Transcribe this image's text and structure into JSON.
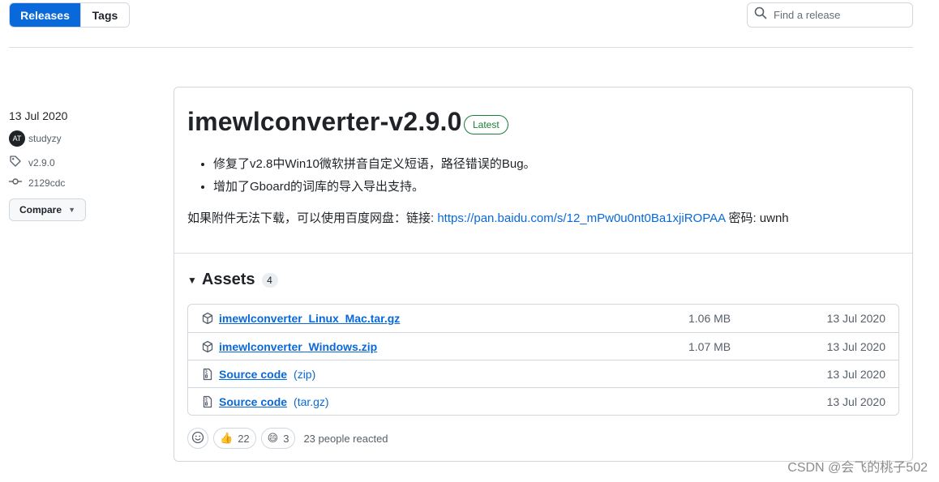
{
  "tabs": [
    {
      "label": "Releases",
      "active": true
    },
    {
      "label": "Tags",
      "active": false
    }
  ],
  "search": {
    "placeholder": "Find a release",
    "value": ""
  },
  "sidebar": {
    "date": "13 Jul 2020",
    "author": "studyzy",
    "avatar_text": "AT",
    "tag": "v2.9.0",
    "commit": "2129cdc",
    "compare_label": "Compare"
  },
  "release": {
    "title": "imewlconverter-v2.9.0",
    "badge": "Latest",
    "notes": [
      "修复了v2.8中Win10微软拼音自定义短语，路径错误的Bug。",
      "增加了Gboard的词库的导入导出支持。"
    ],
    "mirror_prefix": "如果附件无法下载，可以使用百度网盘：链接: ",
    "mirror_link": "https://pan.baidu.com/s/12_mPw0u0nt0Ba1xjiROPAA",
    "mirror_suffix": " 密码: uwnh"
  },
  "assets": {
    "heading": "Assets",
    "count": "4",
    "items": [
      {
        "icon": "package-icon",
        "name": "imewlconverter_Linux_Mac.tar.gz",
        "format": "",
        "size": "1.06 MB",
        "date": "13 Jul 2020"
      },
      {
        "icon": "package-icon",
        "name": "imewlconverter_Windows.zip",
        "format": "",
        "size": "1.07 MB",
        "date": "13 Jul 2020"
      },
      {
        "icon": "file-zip-icon",
        "name": "Source code",
        "format": "(zip)",
        "size": "",
        "date": "13 Jul 2020"
      },
      {
        "icon": "file-zip-icon",
        "name": "Source code",
        "format": "(tar.gz)",
        "size": "",
        "date": "13 Jul 2020"
      }
    ]
  },
  "reactions": {
    "thumbs_up": "22",
    "laugh": "3",
    "summary": "23 people reacted"
  },
  "watermark": "CSDN @会飞的桃子502",
  "colors": {
    "accent": "#0969da",
    "latest_green": "#1a7f37",
    "border": "#d0d7de"
  }
}
